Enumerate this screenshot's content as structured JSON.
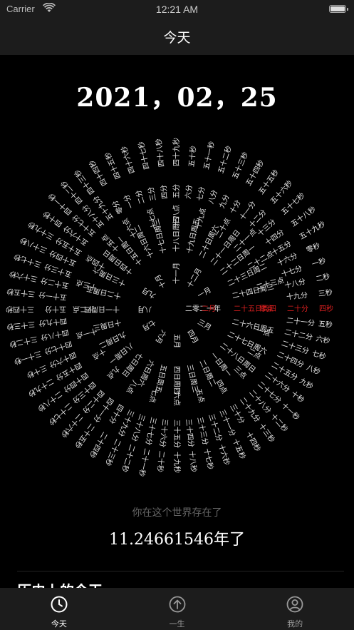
{
  "status_bar": {
    "carrier": "Carrier",
    "time": "12:21 AM"
  },
  "nav": {
    "title": "今天"
  },
  "date_heading": "2021，02，25",
  "clock": {
    "current_color": "#e02020",
    "rings": [
      {
        "name": "year",
        "labels": [
          "二零二一年"
        ],
        "current_index": 0
      },
      {
        "name": "month",
        "labels": [
          "一月",
          "二月",
          "三月",
          "四月",
          "五月",
          "六月",
          "七月",
          "八月",
          "九月",
          "十月",
          "十一月",
          "十二月"
        ],
        "current_index": 1
      },
      {
        "name": "day",
        "labels": [
          "一日周一",
          "二日周二",
          "三日周三",
          "四日周四",
          "五日周五",
          "六日周六",
          "七日周日",
          "八日周一",
          "九日周二",
          "十日周三",
          "十一日周四",
          "十二日周五",
          "十三日周六",
          "十四日周日",
          "十五日周一",
          "十六日周二",
          "十七日周三",
          "十八日周四",
          "十九日周五",
          "二十日周六",
          "二十一日周日",
          "二十二日周一",
          "二十三日周二",
          "二十四日周三",
          "二十五日周四",
          "二十六日周五",
          "二十七日周六",
          "二十八日周日"
        ],
        "current_index": 24
      },
      {
        "name": "hour",
        "labels": [
          "零点",
          "一点",
          "二点",
          "三点",
          "四点",
          "五点",
          "六点",
          "七点",
          "八点",
          "九点",
          "十点",
          "十一点",
          "十二点",
          "十三点",
          "十四点",
          "十五点",
          "十六点",
          "十七点",
          "十八点",
          "十九点",
          "二十点",
          "二十一点",
          "二十二点",
          "二十三点"
        ],
        "current_index": 0
      },
      {
        "name": "minute",
        "labels": [
          "零分",
          "一分",
          "二分",
          "三分",
          "四分",
          "五分",
          "六分",
          "七分",
          "八分",
          "九分",
          "十分",
          "十一分",
          "十二分",
          "十三分",
          "十四分",
          "十五分",
          "十六分",
          "十七分",
          "十八分",
          "十九分",
          "二十分",
          "二十一分",
          "二十二分",
          "二十三分",
          "二十四分",
          "二十五分",
          "二十六分",
          "二十七分",
          "二十八分",
          "二十九分",
          "三十分",
          "三十一分",
          "三十二分",
          "三十三分",
          "三十四分",
          "三十五分",
          "三十六分",
          "三十七分",
          "三十八分",
          "三十九分",
          "四十分",
          "四十一分",
          "四十二分",
          "四十三分",
          "四十四分",
          "四十五分",
          "四十六分",
          "四十七分",
          "四十八分",
          "四十九分",
          "五十分",
          "五十一分",
          "五十二分",
          "五十三分",
          "五十四分",
          "五十五分",
          "五十六分",
          "五十七分",
          "五十八分",
          "五十九分"
        ],
        "current_index": 20
      },
      {
        "name": "second",
        "labels": [
          "零秒",
          "一秒",
          "二秒",
          "三秒",
          "四秒",
          "五秒",
          "六秒",
          "七秒",
          "八秒",
          "九秒",
          "十秒",
          "十一秒",
          "十二秒",
          "十三秒",
          "十四秒",
          "十五秒",
          "十六秒",
          "十七秒",
          "十八秒",
          "十九秒",
          "二十秒",
          "二十一秒",
          "二十二秒",
          "二十三秒",
          "二十四秒",
          "二十五秒",
          "二十六秒",
          "二十七秒",
          "二十八秒",
          "二十九秒",
          "三十秒",
          "三十一秒",
          "三十二秒",
          "三十三秒",
          "三十四秒",
          "三十五秒",
          "三十六秒",
          "三十七秒",
          "三十八秒",
          "三十九秒",
          "四十秒",
          "四十一秒",
          "四十二秒",
          "四十三秒",
          "四十四秒",
          "四十五秒",
          "四十六秒",
          "四十七秒",
          "四十八秒",
          "四十九秒",
          "五十秒",
          "五十一秒",
          "五十二秒",
          "五十三秒",
          "五十四秒",
          "五十五秒",
          "五十六秒",
          "五十七秒",
          "五十八秒",
          "五十九秒"
        ],
        "current_index": 4
      }
    ]
  },
  "existence": {
    "label": "你在这个世界存在了",
    "number": "11.24661546",
    "unit": "年了"
  },
  "history": {
    "title": "历史上的今天"
  },
  "tabs": [
    {
      "label": "今天",
      "icon": "clock-icon",
      "active": true
    },
    {
      "label": "一生",
      "icon": "arrow-up-circle-icon",
      "active": false
    },
    {
      "label": "我的",
      "icon": "user-circle-icon",
      "active": false
    }
  ]
}
